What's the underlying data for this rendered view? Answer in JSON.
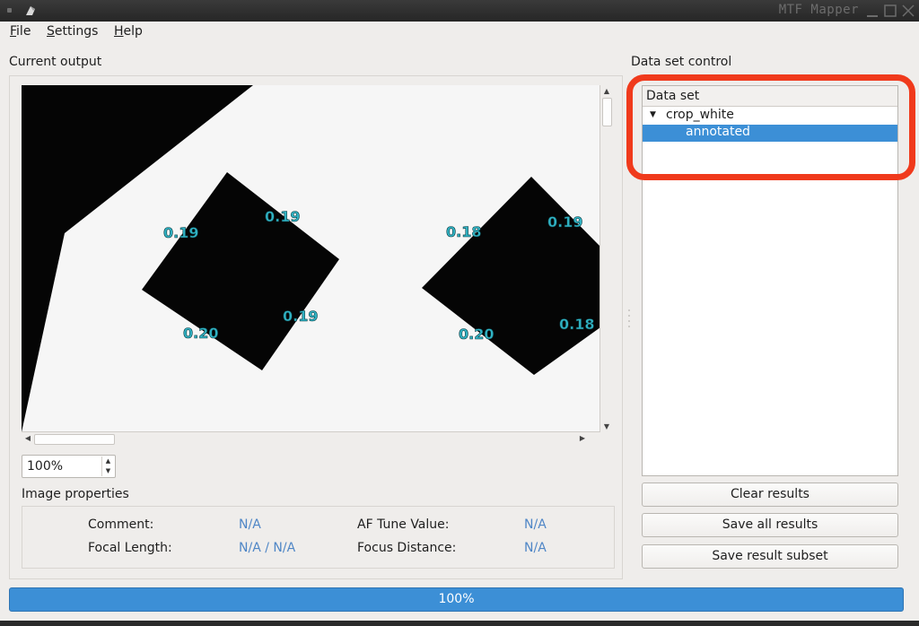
{
  "window": {
    "title": "MTF Mapper",
    "controls": [
      "minimize-icon",
      "maximize-icon",
      "close-icon"
    ]
  },
  "menu": {
    "file_u": "F",
    "file_rest": "ile",
    "settings_u": "S",
    "settings_rest": "ettings",
    "help_u": "H",
    "help_rest": "elp"
  },
  "left": {
    "section_label": "Current output",
    "image": {
      "mtf_labels": [
        "0.19",
        "0.19",
        "0.20",
        "0.19",
        "0.18",
        "0.19",
        "0.20",
        "0.18"
      ],
      "label_color": "#30b3c4"
    },
    "zoom": {
      "value": "100%"
    },
    "properties": {
      "heading": "Image properties",
      "comment_label": "Comment:",
      "comment_value": "N/A",
      "focal_label": "Focal Length:",
      "focal_value": "N/A / N/A",
      "af_label": "AF Tune Value:",
      "af_value": "N/A",
      "focus_label": "Focus Distance:",
      "focus_value": "N/A"
    }
  },
  "right": {
    "section_label": "Data set control",
    "tree": {
      "header": "Data set",
      "parent": "crop_white",
      "child": "annotated"
    },
    "buttons": {
      "clear": "Clear results",
      "save_all": "Save all results",
      "save_subset": "Save result subset"
    }
  },
  "progress": {
    "label": "100%",
    "value": 1.0
  },
  "colors": {
    "accent": "#3c8fd6",
    "highlight": "#f03a1c"
  }
}
